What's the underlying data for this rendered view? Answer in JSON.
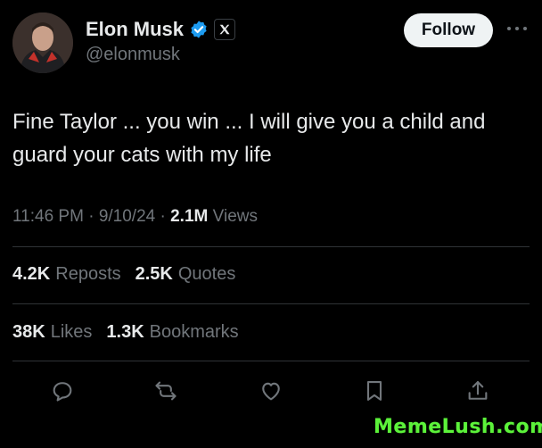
{
  "author": {
    "name": "Elon Musk",
    "handle": "@elonmusk",
    "follow_label": "Follow"
  },
  "tweet": {
    "line1": "Fine Taylor ... you win ... I will give you a child and",
    "line2": "guard your cats with my life"
  },
  "meta": {
    "time": "11:46 PM",
    "date": "9/10/24",
    "views_count": "2.1M",
    "views_label": "Views"
  },
  "stats": {
    "reposts_count": "4.2K",
    "reposts_label": "Reposts",
    "quotes_count": "2.5K",
    "quotes_label": "Quotes",
    "likes_count": "38K",
    "likes_label": "Likes",
    "bookmarks_count": "1.3K",
    "bookmarks_label": "Bookmarks"
  },
  "icons": {
    "verified": "verified-badge-icon",
    "affiliate": "x-logo-icon",
    "more": "more-icon",
    "reply": "reply-icon",
    "repost": "repost-icon",
    "like": "like-icon",
    "bookmark": "bookmark-icon",
    "share": "share-icon"
  },
  "colors": {
    "background": "#000000",
    "text": "#e7e9ea",
    "muted": "#71767b",
    "verified": "#1d9bf0",
    "watermark": "#5cf23a"
  },
  "watermark": "MemeLush.com"
}
